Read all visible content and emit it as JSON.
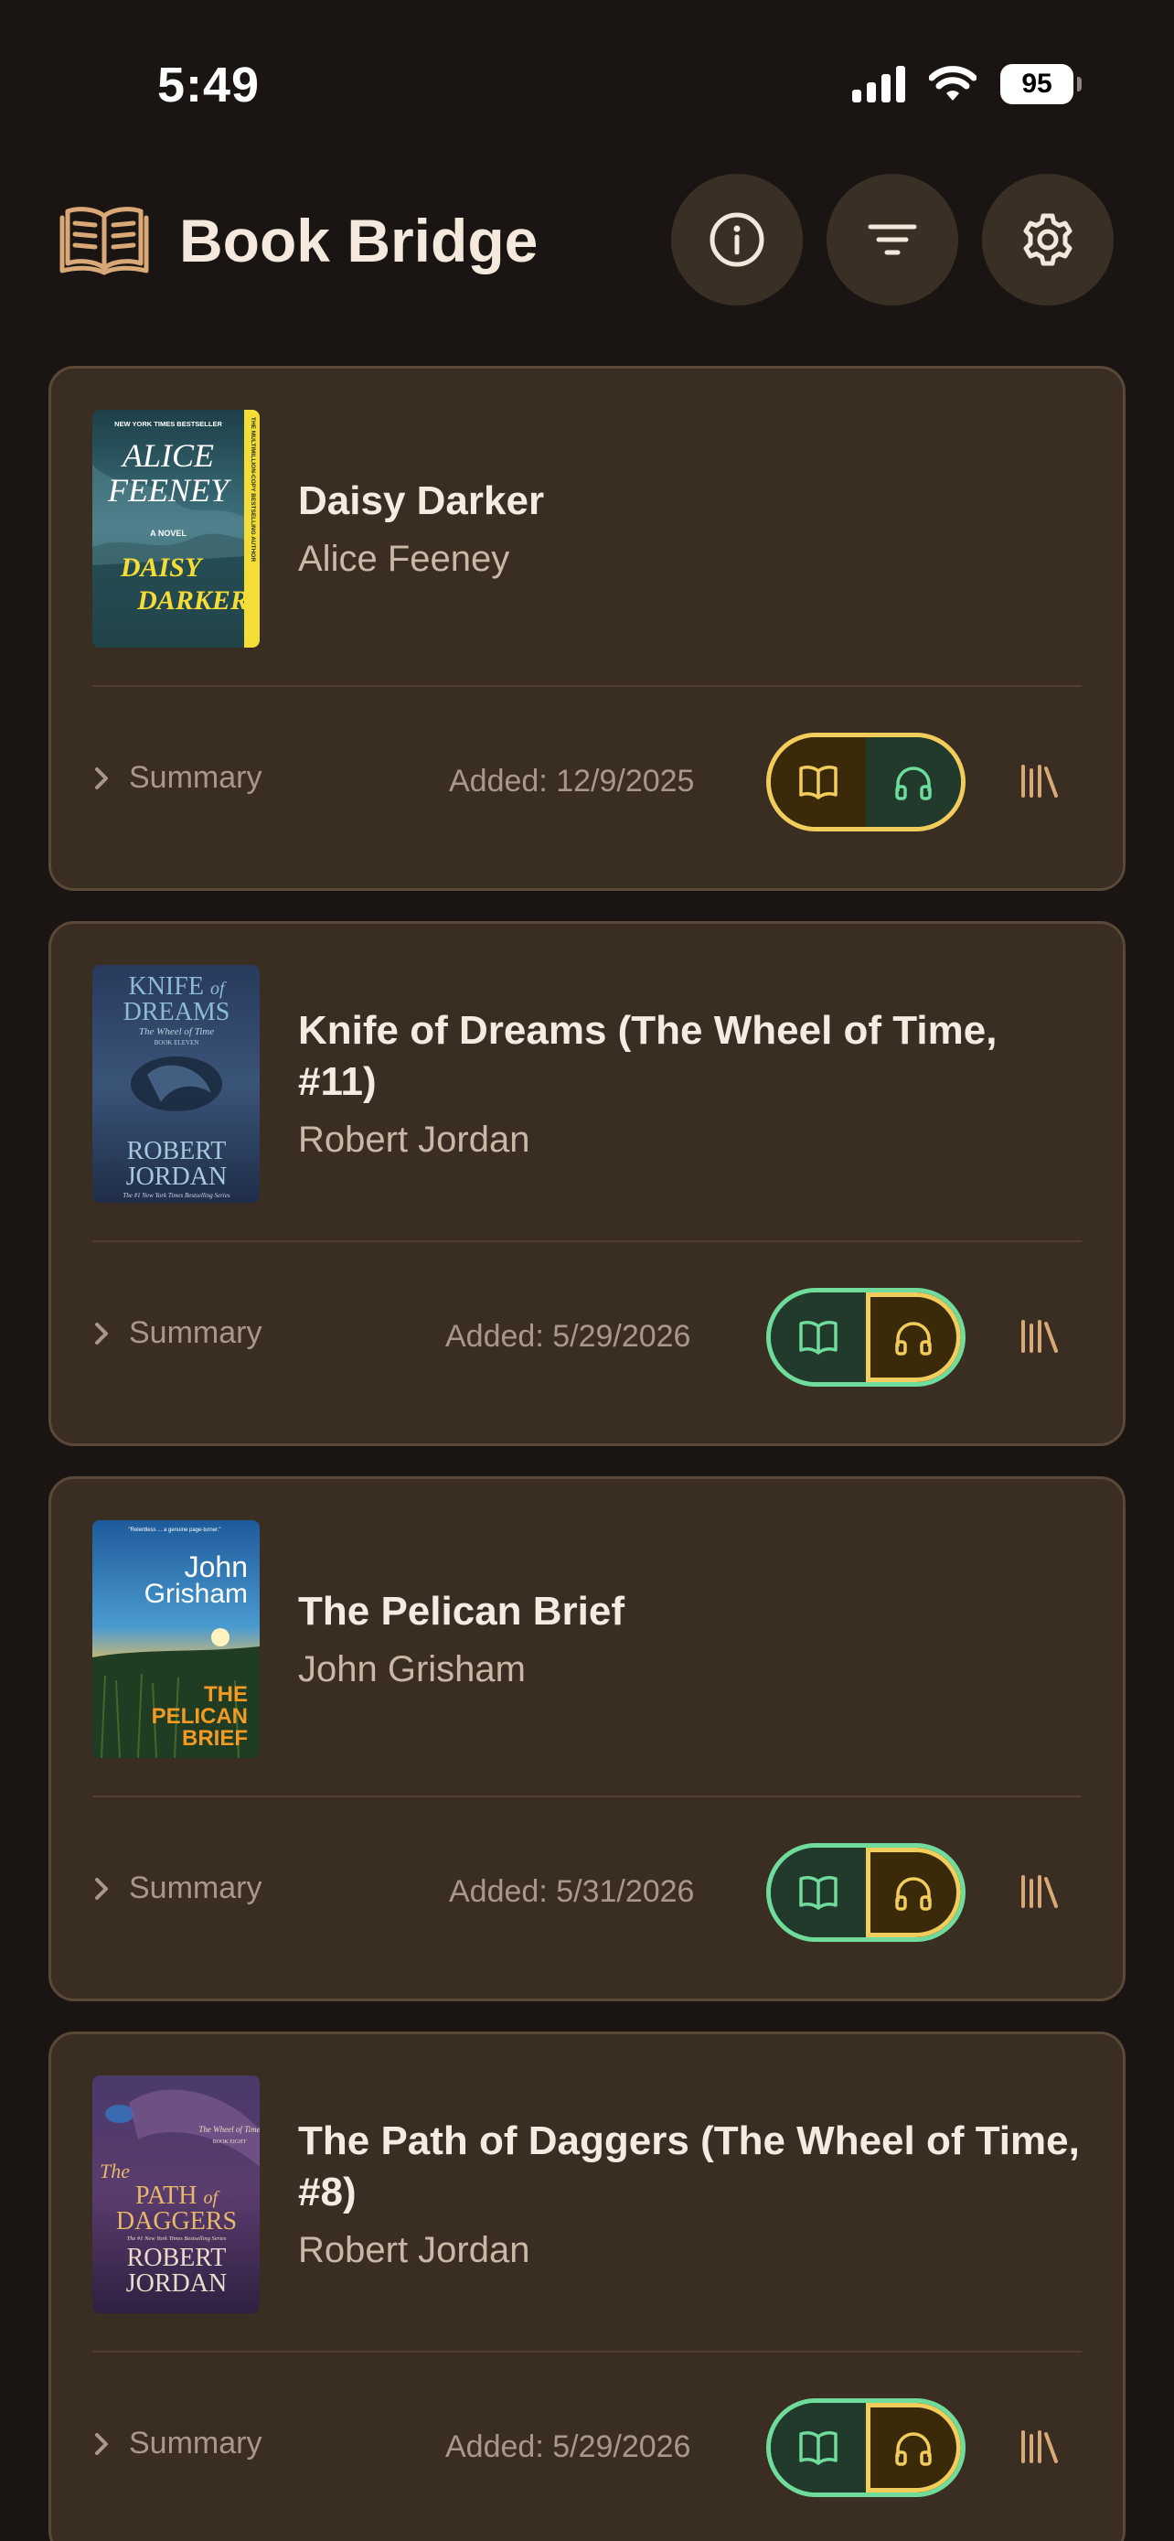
{
  "status": {
    "time": "5:49",
    "battery": "95"
  },
  "header": {
    "title": "Book Bridge"
  },
  "colors": {
    "background": "#1a1512",
    "card": "#3a2e22",
    "active_yellow": "#f2cd5c",
    "active_green": "#6fdc9c",
    "library_icon": "#d9a877"
  },
  "books": [
    {
      "title": "Daisy Darker",
      "author": "Alice Feeney",
      "summary_label": "Summary",
      "added": "Added: 12/9/2025",
      "active_format": "read",
      "cover": {
        "top_banner": "NEW YORK TIMES BESTSELLER",
        "author": "ALICE FEENEY",
        "tagline": "A NOVEL",
        "title": "DAISY DARKER",
        "spine": "THE MULTIMILLION-COPY BESTSELLING AUTHOR"
      }
    },
    {
      "title": "Knife of Dreams (The Wheel of Time, #11)",
      "author": "Robert Jordan",
      "summary_label": "Summary",
      "added": "Added: 5/29/2026",
      "active_format": "listen",
      "cover": {
        "title_line1": "KNIFE of",
        "title_line2": "DREAMS",
        "series": "The Wheel of Time",
        "book_no": "BOOK ELEVEN",
        "author_line1": "ROBERT",
        "author_line2": "JORDAN",
        "footer": "The #1 New York Times Bestselling Series"
      }
    },
    {
      "title": "The Pelican Brief",
      "author": "John Grisham",
      "summary_label": "Summary",
      "added": "Added: 5/31/2026",
      "active_format": "listen",
      "cover": {
        "author_line1": "John",
        "author_line2": "Grisham",
        "title_line1": "THE",
        "title_line2": "PELICAN",
        "title_line3": "BRIEF"
      }
    },
    {
      "title": "The Path of Daggers (The Wheel of Time, #8)",
      "author": "Robert Jordan",
      "summary_label": "Summary",
      "added": "Added: 5/29/2026",
      "active_format": "listen",
      "cover": {
        "series": "The Wheel of Time",
        "book_no": "BOOK EIGHT",
        "title_line1": "The",
        "title_line2": "PATH of",
        "title_line3": "DAGGERS",
        "footer": "The #1 New York Times Bestselling Series",
        "author_line1": "ROBERT",
        "author_line2": "JORDAN"
      }
    }
  ]
}
